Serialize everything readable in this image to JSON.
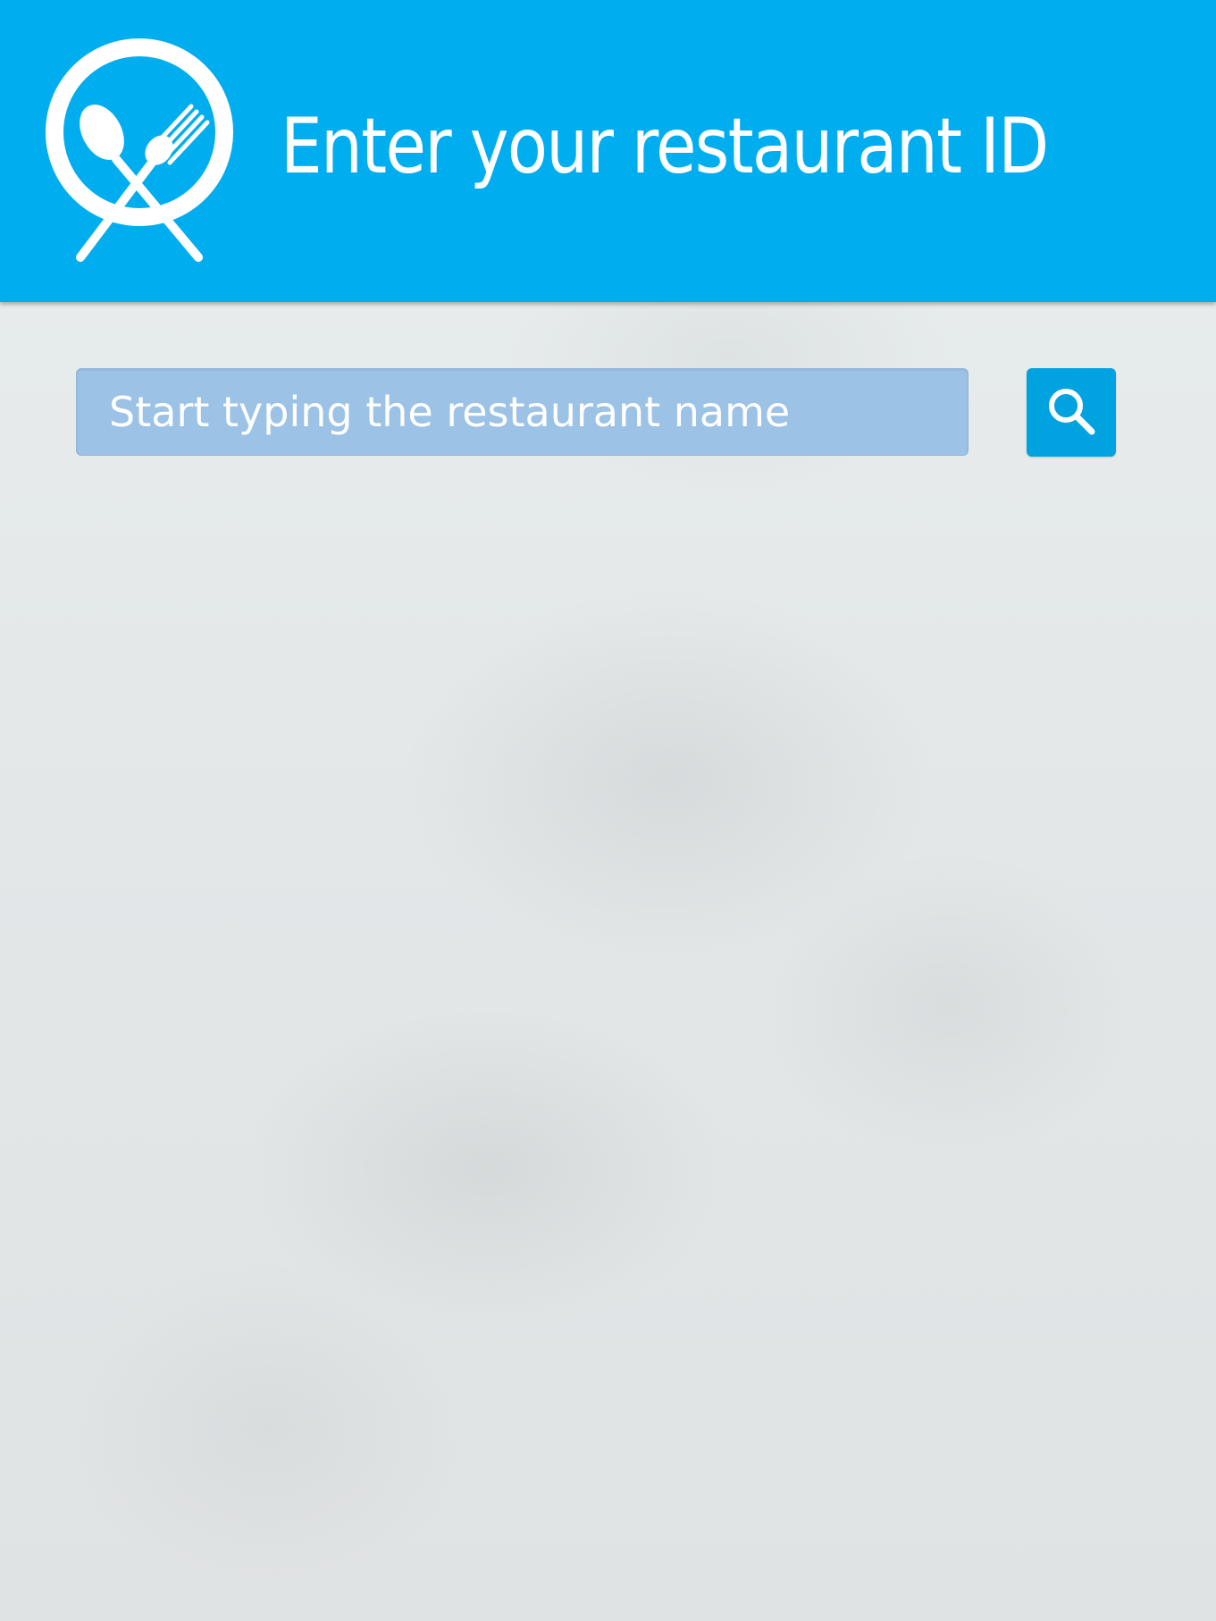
{
  "header": {
    "title": "Enter your restaurant ID",
    "logo_icon": "plate-spoon-fork-icon",
    "background_color": "#00aeef"
  },
  "search": {
    "placeholder": "Start typing the restaurant name",
    "value": "",
    "button_icon": "search-icon",
    "input_color": "#9cc2e6",
    "button_color": "#00a2e0"
  }
}
